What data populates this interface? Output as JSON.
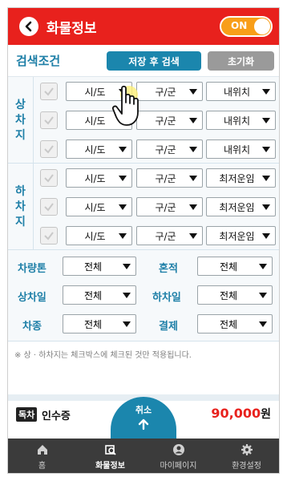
{
  "header": {
    "title": "화물정보",
    "toggle_label": "ON"
  },
  "search": {
    "label": "검색조건",
    "save_label": "저장 후 검색",
    "reset_label": "초기화"
  },
  "load_section": {
    "label": [
      "상",
      "차",
      "지"
    ],
    "rows": [
      {
        "city": "시/도",
        "district": "구/군",
        "option": "내위치"
      },
      {
        "city": "시/도",
        "district": "구/군",
        "option": "내위치"
      },
      {
        "city": "시/도",
        "district": "구/군",
        "option": "내위치"
      }
    ]
  },
  "unload_section": {
    "label": [
      "하",
      "차",
      "지"
    ],
    "rows": [
      {
        "city": "시/도",
        "district": "구/군",
        "option": "최저운임"
      },
      {
        "city": "시/도",
        "district": "구/군",
        "option": "최저운임"
      },
      {
        "city": "시/도",
        "district": "구/군",
        "option": "최저운임"
      }
    ]
  },
  "filters": {
    "tonnage": {
      "label": "차량톤",
      "value": "전체"
    },
    "mixed": {
      "label": "혼적",
      "value": "전체"
    },
    "load_day": {
      "label": "상차일",
      "value": "전체"
    },
    "unload_day": {
      "label": "하차일",
      "value": "전체"
    },
    "car_type": {
      "label": "차종",
      "value": "전체"
    },
    "payment": {
      "label": "결제",
      "value": "전체"
    }
  },
  "notice": "※ 상 · 하차지는 체크박스에 체크된 것만 적용됩니다.",
  "list_peek": {
    "badge": "독차",
    "item": "인수증",
    "price": "90,000",
    "unit": "원"
  },
  "cancel_label": "취소",
  "bottom_nav": [
    {
      "label": "홈",
      "icon": "home-icon"
    },
    {
      "label": "화물정보",
      "icon": "cargo-search-icon"
    },
    {
      "label": "마이페이지",
      "icon": "user-icon"
    },
    {
      "label": "환경설정",
      "icon": "gear-icon"
    }
  ],
  "colors": {
    "header": "#e8211d",
    "accent": "#1b86ad",
    "toggle": "#f89e19",
    "nav": "#3b3b3b"
  }
}
